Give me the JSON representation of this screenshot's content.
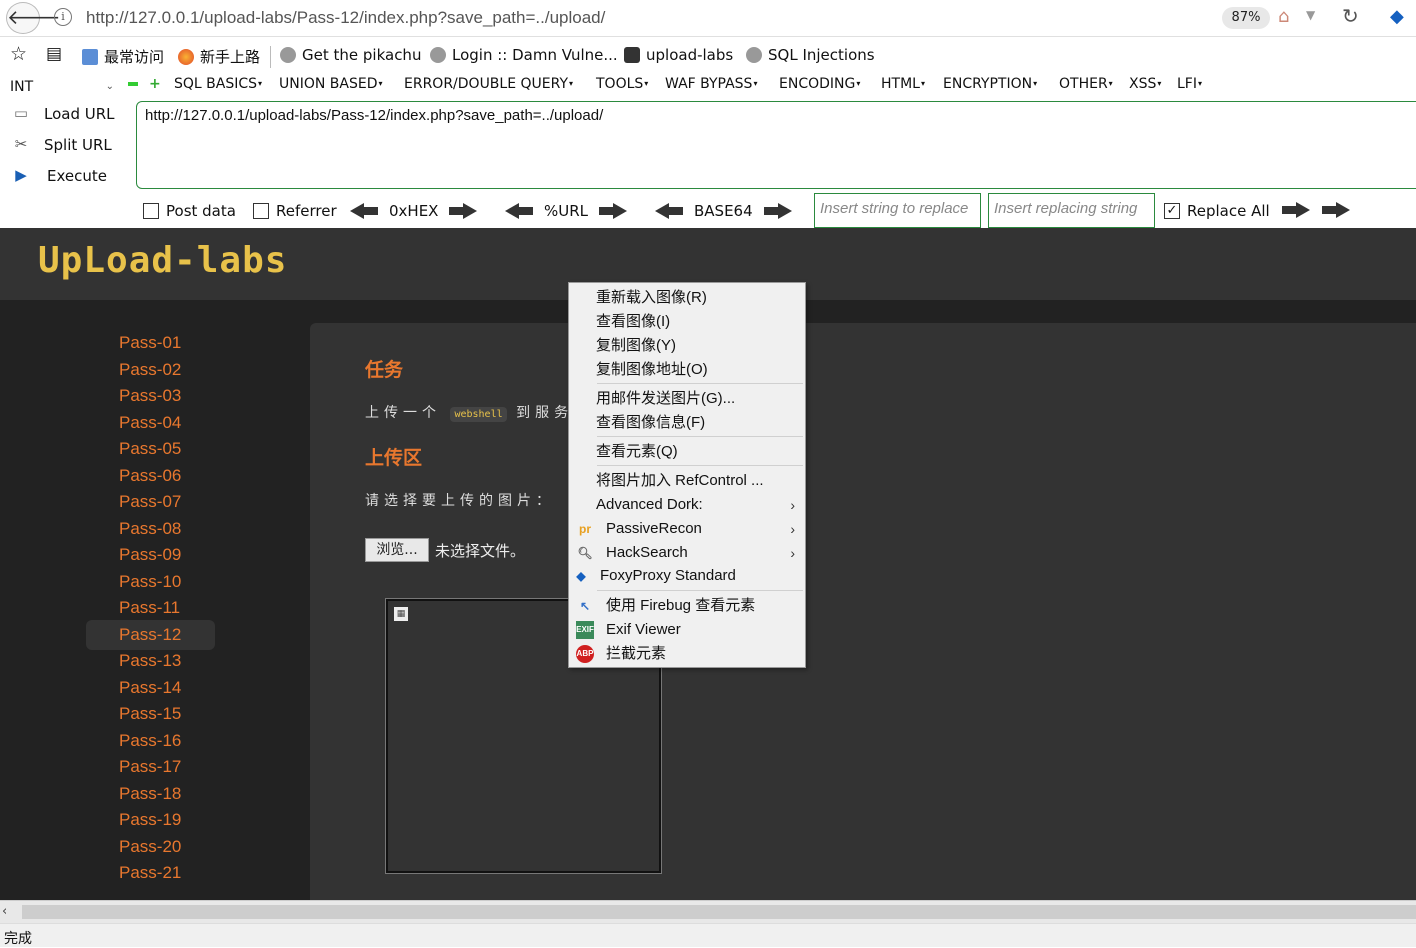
{
  "browser": {
    "url": "http://127.0.0.1/upload-labs/Pass-12/index.php?save_path=../upload/",
    "zoom": "87%"
  },
  "bookmarks": [
    {
      "label": "最常访问",
      "icon": "calendar-icon"
    },
    {
      "label": "新手上路",
      "icon": "firefox-icon"
    },
    {
      "label": "Get the pikachu",
      "icon": "globe-icon"
    },
    {
      "label": "Login :: Damn Vulne...",
      "icon": "globe-icon"
    },
    {
      "label": "upload-labs",
      "icon": "folder-icon"
    },
    {
      "label": "SQL Injections",
      "icon": "globe-icon"
    }
  ],
  "hackbar": {
    "select_value": "INT",
    "menus": [
      "SQL BASICS",
      "UNION BASED",
      "ERROR/DOUBLE QUERY",
      "TOOLS",
      "WAF BYPASS",
      "ENCODING",
      "HTML",
      "ENCRYPTION",
      "OTHER",
      "XSS",
      "LFI"
    ],
    "load_url": "Load URL",
    "split_url": "Split URL",
    "execute": "Execute",
    "url_value": "http://127.0.0.1/upload-labs/Pass-12/index.php?save_path=../upload/",
    "post_data": "Post data",
    "referrer": "Referrer",
    "hex": "0xHEX",
    "urlenc": "%URL",
    "base64": "BASE64",
    "replace_placeholder": "Insert string to replace",
    "replacing_placeholder": "Insert replacing string",
    "replace_all": "Replace All"
  },
  "site": {
    "logo": "UpLoad-labs",
    "passes": [
      "Pass-01",
      "Pass-02",
      "Pass-03",
      "Pass-04",
      "Pass-05",
      "Pass-06",
      "Pass-07",
      "Pass-08",
      "Pass-09",
      "Pass-10",
      "Pass-11",
      "Pass-12",
      "Pass-13",
      "Pass-14",
      "Pass-15",
      "Pass-16",
      "Pass-17",
      "Pass-18",
      "Pass-19",
      "Pass-20",
      "Pass-21"
    ],
    "active_pass": "Pass-12",
    "task_title": "任务",
    "task_prefix": "上传一个",
    "task_code": "webshell",
    "task_suffix": "到服务",
    "upload_title": "上传区",
    "upload_prompt": "请选择要上传的图片：",
    "browse": "浏览...",
    "no_file": "未选择文件。"
  },
  "context_menu": {
    "items": [
      {
        "label": "重新载入图像(R)"
      },
      {
        "label": "查看图像(I)"
      },
      {
        "label": "复制图像(Y)"
      },
      {
        "label": "复制图像地址(O)"
      },
      {
        "label": "用邮件发送图片(G)..."
      },
      {
        "label": "查看图像信息(F)"
      },
      {
        "label": "查看元素(Q)"
      },
      {
        "label": "将图片加入 RefControl ..."
      },
      {
        "label": "Advanced Dork:"
      },
      {
        "label": "PassiveRecon"
      },
      {
        "label": "HackSearch"
      },
      {
        "label": "FoxyProxy Standard"
      },
      {
        "label": "使用 Firebug 查看元素"
      },
      {
        "label": "Exif Viewer"
      },
      {
        "label": "拦截元素"
      }
    ]
  },
  "status": "完成"
}
